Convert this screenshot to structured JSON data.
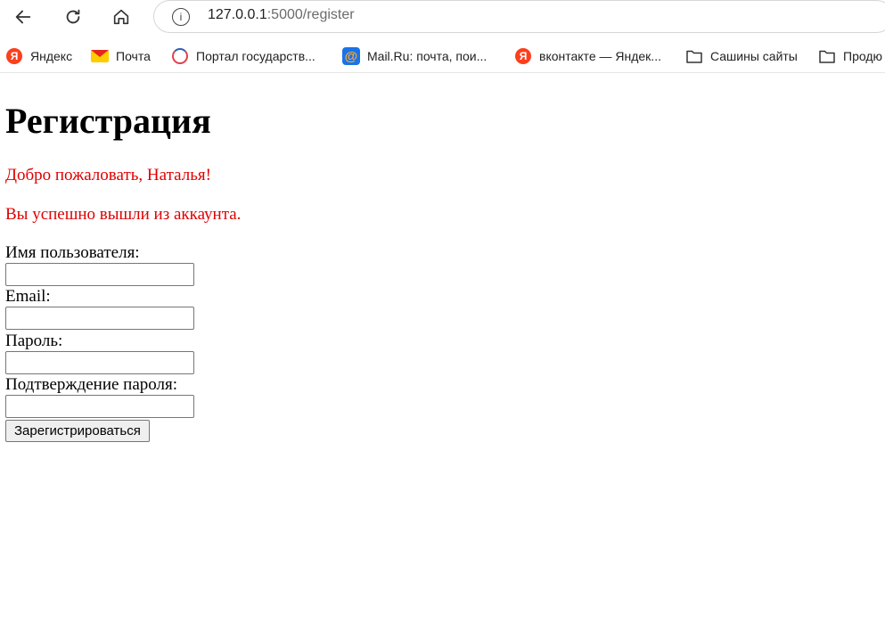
{
  "browser": {
    "url_host": "127.0.0.1",
    "url_rest": ":5000/register",
    "bookmarks": [
      {
        "label": "Яндекс",
        "icon": "yandex-icon"
      },
      {
        "label": "Почта",
        "icon": "mail-icon"
      },
      {
        "label": "Портал государств...",
        "icon": "gosuslugi-icon"
      },
      {
        "label": "Mail.Ru: почта, пои...",
        "icon": "mailru-icon"
      },
      {
        "label": "вконтакте — Яндек...",
        "icon": "yandex-icon"
      },
      {
        "label": "Сашины сайты",
        "icon": "folder-icon"
      },
      {
        "label": "Продю",
        "icon": "folder-icon"
      }
    ]
  },
  "page": {
    "title": "Регистрация",
    "messages": [
      "Добро пожаловать, Наталья!",
      "Вы успешно вышли из аккаунта."
    ],
    "form": {
      "username_label": "Имя пользователя:",
      "username_value": "",
      "email_label": "Email:",
      "email_value": "",
      "password_label": "Пароль:",
      "password_value": "",
      "confirm_label": "Подтверждение пароля:",
      "confirm_value": "",
      "submit_label": "Зарегистрироваться"
    },
    "colors": {
      "message": "#e00000",
      "text": "#000000"
    }
  }
}
